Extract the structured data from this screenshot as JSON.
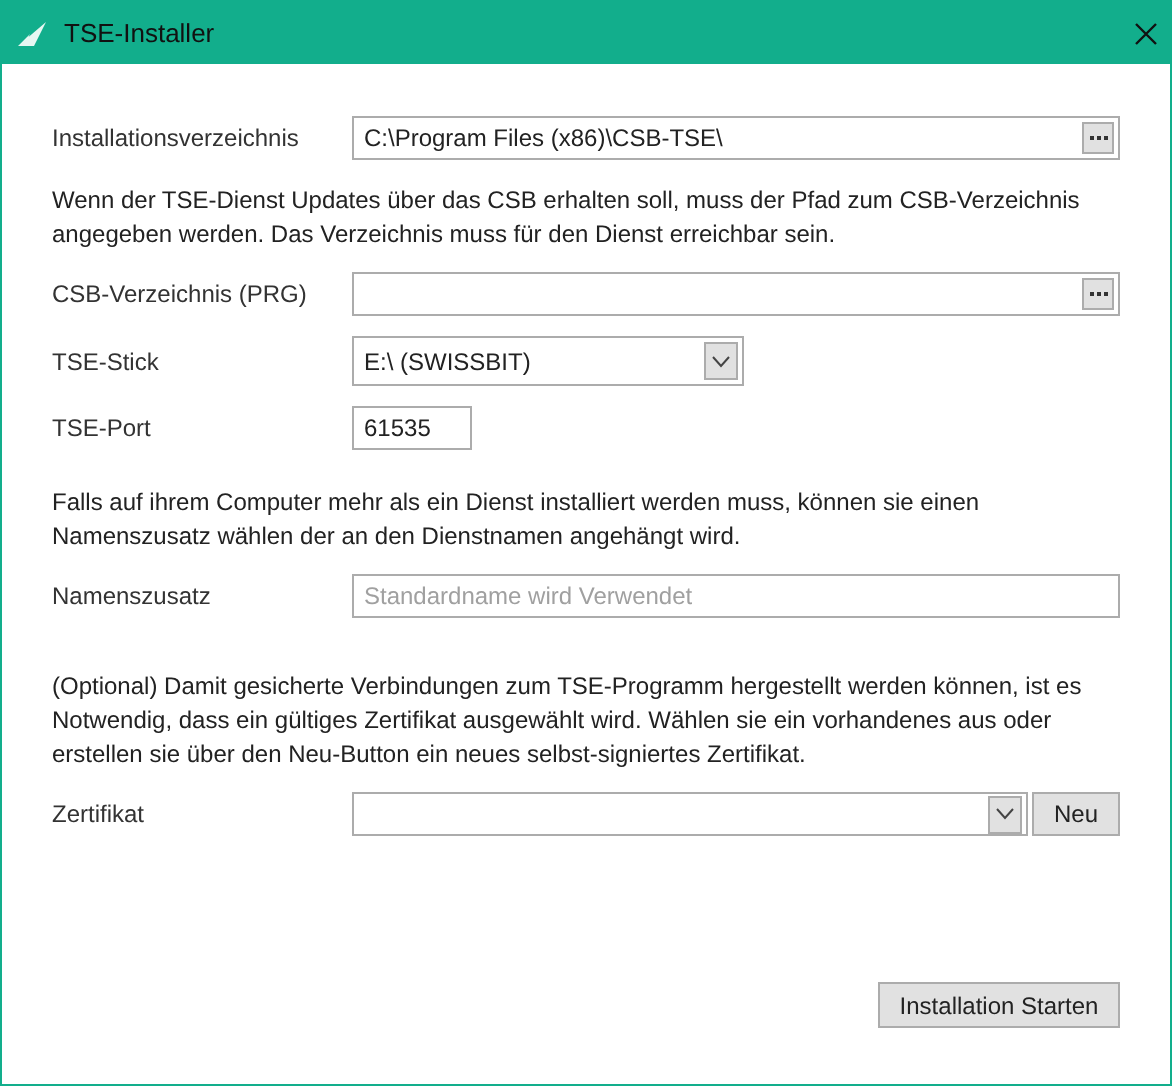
{
  "window": {
    "title": "TSE-Installer"
  },
  "items": [
    {
      "kind": "path",
      "label": "Installationsverzeichnis",
      "value": "C:\\Program Files (x86)\\CSB-TSE\\"
    },
    {
      "kind": "note",
      "lines": [
        "Wenn der TSE-Dienst Updates über das CSB erhalten soll, muss der Pfad zum CSB-Verzeichnis",
        "angegeben werden. Das Verzeichnis muss für den Dienst erreichbar sein."
      ]
    },
    {
      "kind": "path",
      "label": "CSB-Verzeichnis (PRG)"
    },
    {
      "kind": "combo",
      "label": "TSE-Stick",
      "value": "E:\\ (SWISSBIT)"
    },
    {
      "kind": "text",
      "label": "TSE-Port",
      "value": "61535"
    },
    {
      "kind": "note",
      "lines": [
        "Falls auf ihrem Computer mehr als ein Dienst installiert werden muss, können sie einen",
        "Namenszusatz wählen der an den Dienstnamen angehängt wird."
      ]
    },
    {
      "kind": "wide_text",
      "label": "Namenszusatz",
      "placeholder": "Standardname wird Verwendet"
    },
    {
      "kind": "note",
      "lines": [
        "(Optional) Damit gesicherte Verbindungen zum TSE-Programm hergestellt werden können, ist es",
        "Notwendig, dass ein gültiges Zertifikat ausgewählt wird. Wählen sie ein vorhandenes aus oder",
        "erstellen sie über den Neu-Button ein neues selbst-signiertes Zertifikat."
      ]
    },
    {
      "kind": "combo_new",
      "label": "Zertifikat",
      "button": "Neu"
    }
  ],
  "footer": {
    "button": "Installation Starten"
  }
}
